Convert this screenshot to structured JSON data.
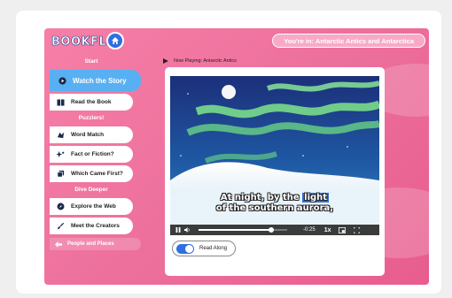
{
  "header": {
    "logo_text": "BOOKFLIX",
    "location_label": "You're in: Antarctic Antics and Antarctica"
  },
  "sidebar": {
    "sections": [
      {
        "title": "Start"
      },
      {
        "title": "Puzzlers!"
      },
      {
        "title": "Dive Deeper"
      }
    ],
    "items": [
      {
        "label": "Watch the Story",
        "icon": "play-circle-icon",
        "active": true
      },
      {
        "label": "Read the Book",
        "icon": "book-icon"
      },
      {
        "label": "Word Match",
        "icon": "word-match-icon"
      },
      {
        "label": "Fact or Fiction?",
        "icon": "sparkle-icon"
      },
      {
        "label": "Which Came First?",
        "icon": "cards-icon"
      },
      {
        "label": "Explore the Web",
        "icon": "compass-icon"
      },
      {
        "label": "Meet the Creators",
        "icon": "paint-brush-icon"
      }
    ],
    "footer_link": {
      "label": "People and Places",
      "icon": "arrow-left-icon"
    }
  },
  "now_playing": {
    "label": "Now Playing: Antarctic Antics"
  },
  "player": {
    "caption_line1_before": "At night, by the ",
    "caption_highlight": "light",
    "caption_line2": "of the southern aurora,",
    "time_remaining": "-0:25",
    "speed": "1x",
    "progress_fraction": 0.82
  },
  "read_along": {
    "label": "Read Along",
    "enabled": true
  },
  "colors": {
    "brand_pink": "#ec6e9b",
    "active_blue": "#58b0f2",
    "accent_blue": "#2f6fe0"
  }
}
